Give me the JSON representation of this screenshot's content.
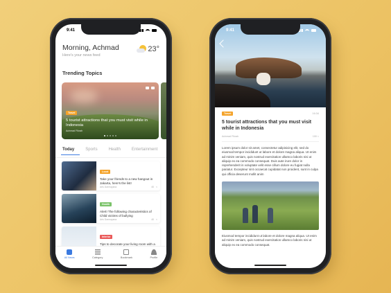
{
  "left_phone": {
    "status_time": "9:41",
    "greeting": "Morning, Achmad",
    "subtitle": "Here's your news feed",
    "temperature": "23°",
    "weather_icon": "partly-cloudy-icon",
    "section_title": "Trending Topics",
    "hero": {
      "tag": "Travel",
      "title": "5 tourist attractions that you must visit while in Indonesia",
      "author": "Achmad Fikrah"
    },
    "tabs": [
      "Today",
      "Sports",
      "Health",
      "Entertainment"
    ],
    "news": [
      {
        "tag": "Local",
        "title": "Take your friends to a new hangout in Jakarta, here's the list!",
        "author": "Aris Darmayana",
        "comments": "40"
      },
      {
        "tag": "Health",
        "title": "Alert! The following characteristics of Child victims of bullying",
        "author": "Aris Darmayana",
        "comments": "40"
      },
      {
        "tag": "Interior",
        "title": "Tips to decorate your living room with a",
        "author": "",
        "comments": ""
      }
    ],
    "nav": [
      {
        "label": "All News",
        "icon": "newspaper-icon"
      },
      {
        "label": "Category",
        "icon": "list-icon"
      },
      {
        "label": "Bookmark",
        "icon": "bookmark-icon"
      },
      {
        "label": "Profile",
        "icon": "user-icon"
      }
    ]
  },
  "right_phone": {
    "status_time": "9:41",
    "tag": "Travel",
    "time": "16:34",
    "title": "5 tourist attractions that you must visit while in Indonesia",
    "author": "Achmad Fikrah",
    "comments": "100",
    "para1": "Lorem ipsum dolor sit amet, consectetur adipisicing elit, sed do eiusmod tempor incididunt ut labore et dolore magna aliqua. Ut enim ad minim veniam, quis nostrud exercitation ullamco laboris nisi ut aliquip ex ea commodo consequat. Duis aute irure dolor in reprehenderit in voluptate velit esse cillum dolore eu fugiat nulla pariatur. Excepteur sint occaecat cupidatat non proident, sunt in culpa qui officia deserunt mollit anim",
    "para2": "Eiusmod tempor incididunt ut labore et dolore magna aliqua. Ut enim ad minim veniam, quis nostrud exercitation ullamco laboris nisi ut aliquip ex ea commodo consequat."
  }
}
